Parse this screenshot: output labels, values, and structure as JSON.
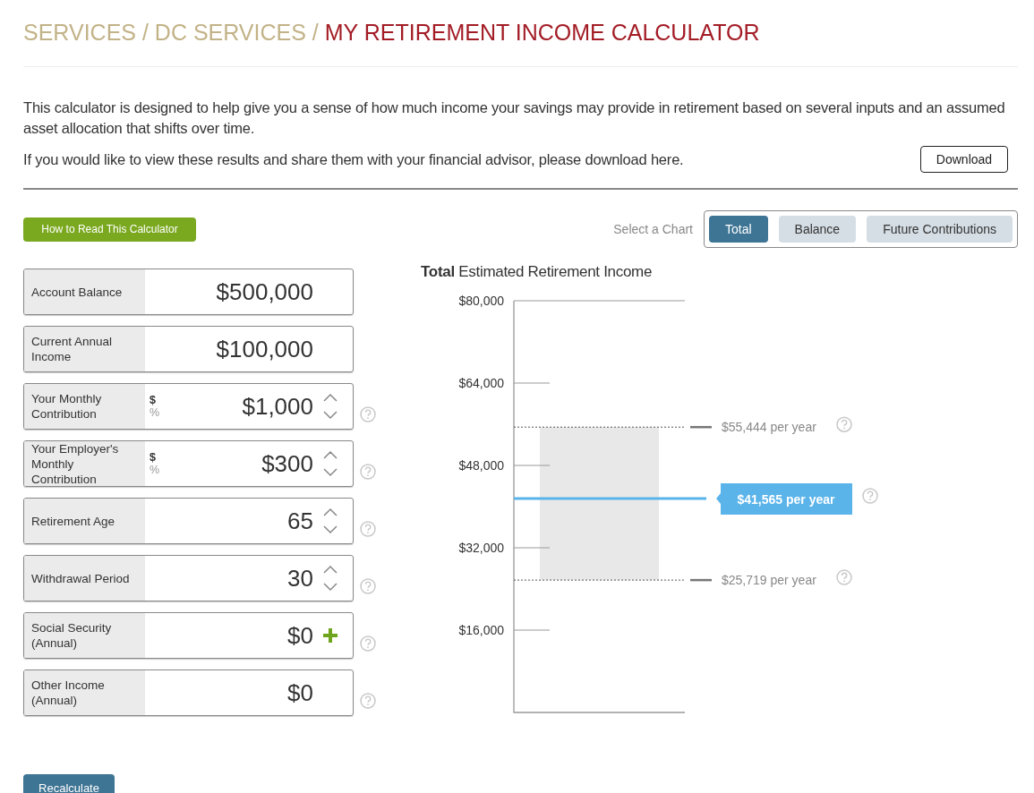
{
  "breadcrumb": {
    "separator": "/",
    "items": [
      {
        "label": "SERVICES",
        "current": false
      },
      {
        "label": "DC SERVICES",
        "current": false
      },
      {
        "label": "MY RETIREMENT INCOME CALCULATOR",
        "current": true
      }
    ]
  },
  "intro": "This calculator is designed to help give you a sense of how much income your savings may provide in retirement based on several inputs and an assumed asset allocation that shifts over time.",
  "download_text": "If you would like to view these results and share them with your financial advisor, please download here.",
  "download_button": "Download",
  "how_to_button": "How to Read This Calculator",
  "chart_select": {
    "label": "Select a Chart",
    "tabs": [
      {
        "label": "Total",
        "selected": true
      },
      {
        "label": "Balance",
        "selected": false
      },
      {
        "label": "Future Contributions",
        "selected": false
      }
    ]
  },
  "fields": [
    {
      "label": "Account Balance",
      "value": "$500,000",
      "kind": "plain",
      "help": false
    },
    {
      "label": "Current Annual Income",
      "value": "$100,000",
      "kind": "plain",
      "help": false
    },
    {
      "label": "Your Monthly Contribution",
      "value": "$1,000",
      "units": [
        {
          "label": "$",
          "selected": true
        },
        {
          "label": "%",
          "selected": false
        }
      ],
      "kind": "stepper",
      "help": true
    },
    {
      "label": "Your Employer's Monthly Contribution",
      "value": "$300",
      "units": [
        {
          "label": "$",
          "selected": true
        },
        {
          "label": "%",
          "selected": false
        }
      ],
      "kind": "stepper",
      "help": true
    },
    {
      "label": "Retirement Age",
      "value": "65",
      "kind": "stepper",
      "help": true
    },
    {
      "label": "Withdrawal Period",
      "value": "30",
      "kind": "stepper",
      "help": true
    },
    {
      "label": "Social Security (Annual)",
      "value": "$0",
      "kind": "plus",
      "help": true
    },
    {
      "label": "Other Income (Annual)",
      "value": "$0",
      "kind": "plain",
      "help": true
    }
  ],
  "recalculate_button": "Recalculate",
  "chart_data": {
    "type": "bar",
    "title": "**Total** Estimated Retirement Income",
    "ylim": [
      0,
      80000
    ],
    "yticks": [
      {
        "value": 16000,
        "label": "$16,000"
      },
      {
        "value": 32000,
        "label": "$32,000"
      },
      {
        "value": 48000,
        "label": "$48,000"
      },
      {
        "value": 64000,
        "label": "$64,000"
      },
      {
        "value": 80000,
        "label": "$80,000"
      }
    ],
    "categories": [
      null
    ],
    "bands": [
      {
        "axis": "y",
        "from": 25719,
        "to": 55444,
        "color": "#e8e8e8"
      }
    ],
    "ref_lines": [
      {
        "axis": "y",
        "value": 55444,
        "label": "$55,444 per year",
        "color": "#555555"
      },
      {
        "axis": "y",
        "value": 41565,
        "label": "$41,565 per year",
        "color": "#5ab4ea"
      },
      {
        "axis": "y",
        "value": 25719,
        "label": "$25,719 per year",
        "color": "#555555"
      }
    ]
  }
}
